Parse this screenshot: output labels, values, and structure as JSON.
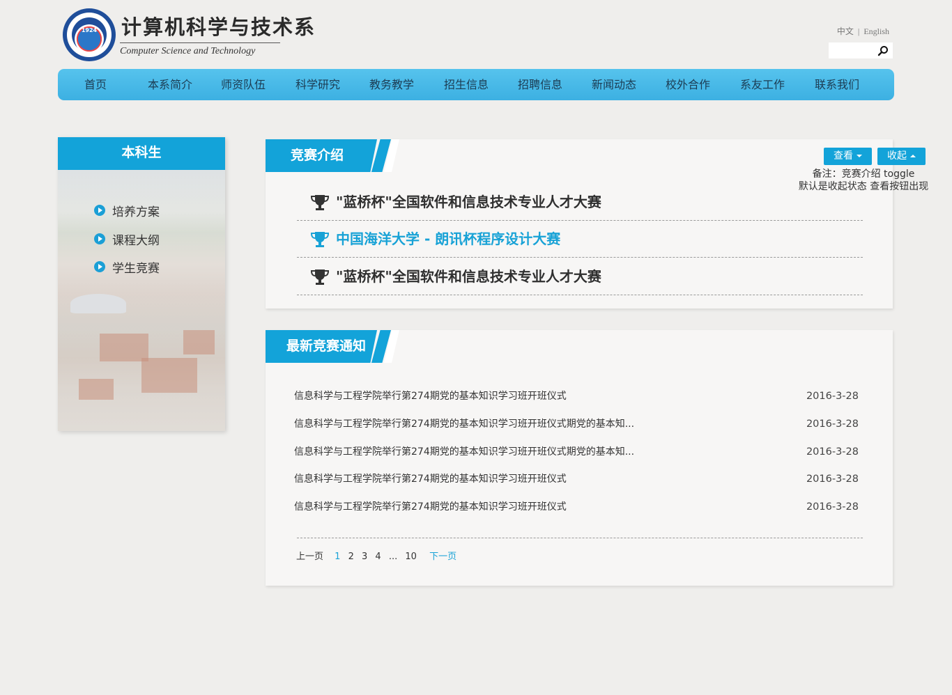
{
  "header": {
    "logo_year": "1924",
    "logo_cn": "计算机科学与技术系",
    "logo_en": "Computer Science and Technology",
    "lang": {
      "zh": "中文",
      "separator": "|",
      "en": "English"
    },
    "search": {
      "value": "",
      "placeholder": ""
    }
  },
  "nav": {
    "items": [
      "首页",
      "本系简介",
      "师资队伍",
      "科学研究",
      "教务教学",
      "招生信息",
      "招聘信息",
      "新闻动态",
      "校外合作",
      "系友工作",
      "联系我们"
    ]
  },
  "sidebar": {
    "title": "本科生",
    "items": [
      "培养方案",
      "课程大纲",
      "学生竞赛"
    ]
  },
  "competition": {
    "tab_label": "竞赛介绍",
    "view_button": "查看",
    "collapse_button": "收起",
    "note_line1": "备注：竞赛介绍 toggle",
    "note_line2": "默认是收起状态 查看按钮出现",
    "items": [
      {
        "title": "\"蓝桥杯\"全国软件和信息技术专业人才大赛"
      },
      {
        "title": "中国海洋大学 - 朗讯杯程序设计大赛"
      },
      {
        "title": "\"蓝桥杯\"全国软件和信息技术专业人才大赛"
      }
    ]
  },
  "notices": {
    "tab_label": "最新竞赛通知",
    "items": [
      {
        "title": "信息科学与工程学院举行第274期党的基本知识学习班开班仪式",
        "date": "2016-3-28"
      },
      {
        "title": "信息科学与工程学院举行第274期党的基本知识学习班开班仪式期党的基本知...",
        "date": "2016-3-28"
      },
      {
        "title": "信息科学与工程学院举行第274期党的基本知识学习班开班仪式期党的基本知...",
        "date": "2016-3-28"
      },
      {
        "title": "信息科学与工程学院举行第274期党的基本知识学习班开班仪式",
        "date": "2016-3-28"
      },
      {
        "title": "信息科学与工程学院举行第274期党的基本知识学习班开班仪式",
        "date": "2016-3-28"
      }
    ],
    "pager": {
      "prev": "上一页",
      "pages": [
        "1",
        "2",
        "3",
        "4"
      ],
      "ellipsis": "...",
      "last": "10",
      "next": "下一页"
    }
  },
  "colors": {
    "accent": "#13a3d9",
    "nav": "#4cbbe8",
    "active_link": "#18a2d6",
    "background": "#efeeec"
  },
  "icons": [
    "search-icon",
    "play-circle-icon",
    "trophy-icon",
    "caret-down-icon",
    "caret-up-icon"
  ]
}
